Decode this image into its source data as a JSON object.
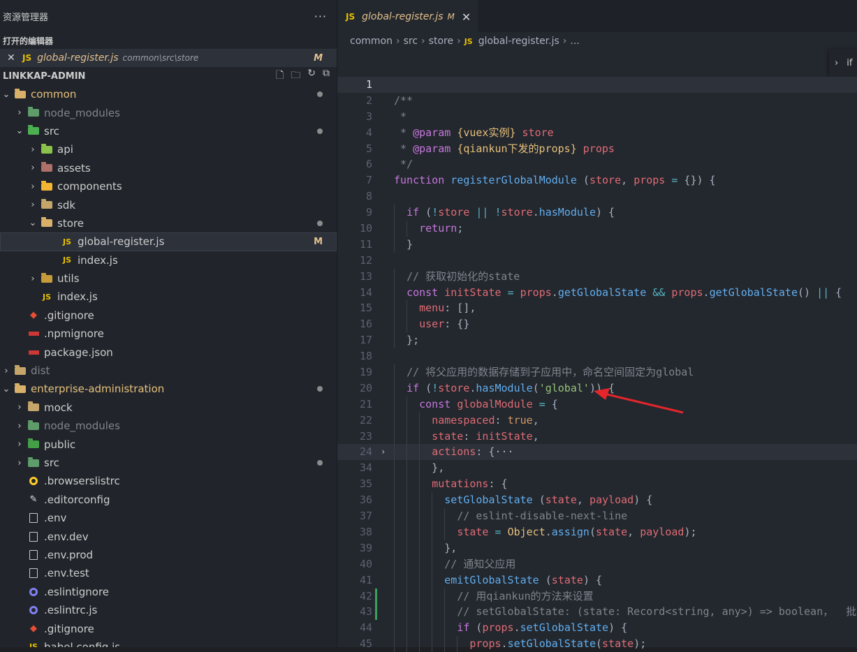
{
  "sidebar": {
    "title": "资源管理器",
    "more": "···",
    "open_editors_title": "打开的编辑器",
    "open_editor": {
      "close": "✕",
      "badge": "JS",
      "name": "global-register.js",
      "path": "common\\src\\store",
      "status": "M"
    },
    "project_title": "LINKKAP-ADMIN",
    "project_actions": [
      "new-file-icon",
      "new-folder-icon",
      "refresh-icon",
      "collapse-all-icon"
    ],
    "tree": [
      {
        "label": "common",
        "depth": 0,
        "kind": "folder-open",
        "chev": "⌄",
        "dot": true,
        "color": "yellow"
      },
      {
        "label": "node_modules",
        "depth": 1,
        "kind": "folder-green",
        "chev": "›",
        "dim": true
      },
      {
        "label": "src",
        "depth": 1,
        "kind": "folder-green-open",
        "chev": "⌄",
        "dot": true
      },
      {
        "label": "api",
        "depth": 2,
        "kind": "folder-api",
        "chev": "›"
      },
      {
        "label": "assets",
        "depth": 2,
        "kind": "folder-assets",
        "chev": "›"
      },
      {
        "label": "components",
        "depth": 2,
        "kind": "folder-comp",
        "chev": "›"
      },
      {
        "label": "sdk",
        "depth": 2,
        "kind": "folder",
        "chev": "›"
      },
      {
        "label": "store",
        "depth": 2,
        "kind": "folder-open",
        "chev": "⌄",
        "dot": true
      },
      {
        "label": "global-register.js",
        "depth": 3,
        "kind": "js",
        "selected": true,
        "mark": "M"
      },
      {
        "label": "index.js",
        "depth": 3,
        "kind": "js"
      },
      {
        "label": "utils",
        "depth": 2,
        "kind": "folder-utils",
        "chev": "›"
      },
      {
        "label": "index.js",
        "depth": 2,
        "kind": "js",
        "nochev": true
      },
      {
        "label": ".gitignore",
        "depth": 1,
        "kind": "git",
        "nochev": true
      },
      {
        "label": ".npmignore",
        "depth": 1,
        "kind": "npm",
        "nochev": true
      },
      {
        "label": "package.json",
        "depth": 1,
        "kind": "npm",
        "nochev": true
      },
      {
        "label": "dist",
        "depth": 0,
        "kind": "folder",
        "chev": "›",
        "dim": true
      },
      {
        "label": "enterprise-administration",
        "depth": 0,
        "kind": "folder-open",
        "chev": "⌄",
        "dot": true,
        "color": "yellow"
      },
      {
        "label": "mock",
        "depth": 1,
        "kind": "folder",
        "chev": "›"
      },
      {
        "label": "node_modules",
        "depth": 1,
        "kind": "folder-green",
        "chev": "›",
        "dim": true
      },
      {
        "label": "public",
        "depth": 1,
        "kind": "folder-public",
        "chev": "›"
      },
      {
        "label": "src",
        "depth": 1,
        "kind": "folder-green",
        "chev": "›",
        "dot": true
      },
      {
        "label": ".browserslistrc",
        "depth": 1,
        "kind": "browsers",
        "nochev": true
      },
      {
        "label": ".editorconfig",
        "depth": 1,
        "kind": "editorconfig",
        "nochev": true
      },
      {
        "label": ".env",
        "depth": 1,
        "kind": "file",
        "nochev": true
      },
      {
        "label": ".env.dev",
        "depth": 1,
        "kind": "file",
        "nochev": true
      },
      {
        "label": ".env.prod",
        "depth": 1,
        "kind": "file",
        "nochev": true
      },
      {
        "label": ".env.test",
        "depth": 1,
        "kind": "file",
        "nochev": true
      },
      {
        "label": ".eslintignore",
        "depth": 1,
        "kind": "eslint",
        "nochev": true
      },
      {
        "label": ".eslintrc.js",
        "depth": 1,
        "kind": "eslint",
        "nochev": true
      },
      {
        "label": ".gitignore",
        "depth": 1,
        "kind": "git",
        "nochev": true
      },
      {
        "label": "babel.config.js",
        "depth": 1,
        "kind": "js",
        "nochev": true
      }
    ]
  },
  "editor": {
    "tab": {
      "badge": "JS",
      "name": "global-register.js",
      "status": "M",
      "close": "✕"
    },
    "breadcrumb": [
      "common",
      "src",
      "store",
      "global-register.js",
      "..."
    ],
    "breadcrumb_badge": "JS",
    "widget_text": "if",
    "lines": [
      {
        "n": "1",
        "t": ""
      },
      {
        "n": "2",
        "t": "/**"
      },
      {
        "n": "3",
        "t": " *"
      },
      {
        "n": "4",
        "t": " * @param {vuex实例} store"
      },
      {
        "n": "5",
        "t": " * @param {qiankun下发的props} props"
      },
      {
        "n": "6",
        "t": " */"
      },
      {
        "n": "7",
        "t": "function registerGlobalModule (store, props = {}) {"
      },
      {
        "n": "8",
        "t": ""
      },
      {
        "n": "9",
        "t": "  if (!store || !store.hasModule) {"
      },
      {
        "n": "10",
        "t": "    return;"
      },
      {
        "n": "11",
        "t": "  }"
      },
      {
        "n": "12",
        "t": ""
      },
      {
        "n": "13",
        "t": "  // 获取初始化的state"
      },
      {
        "n": "14",
        "t": "  const initState = props.getGlobalState && props.getGlobalState() || {"
      },
      {
        "n": "15",
        "t": "    menu: [],"
      },
      {
        "n": "16",
        "t": "    user: {}"
      },
      {
        "n": "17",
        "t": "  };"
      },
      {
        "n": "18",
        "t": ""
      },
      {
        "n": "19",
        "t": "  // 将父应用的数据存储到子应用中，命名空间固定为global"
      },
      {
        "n": "20",
        "t": "  if (!store.hasModule('global')) {"
      },
      {
        "n": "21",
        "t": "    const globalModule = {"
      },
      {
        "n": "22",
        "t": "      namespaced: true,"
      },
      {
        "n": "23",
        "t": "      state: initState,"
      },
      {
        "n": "24",
        "t": "      actions: {···"
      },
      {
        "n": "34",
        "t": "      },"
      },
      {
        "n": "35",
        "t": "      mutations: {"
      },
      {
        "n": "36",
        "t": "        setGlobalState (state, payload) {"
      },
      {
        "n": "37",
        "t": "          // eslint-disable-next-line"
      },
      {
        "n": "38",
        "t": "          state = Object.assign(state, payload);"
      },
      {
        "n": "39",
        "t": "        },"
      },
      {
        "n": "40",
        "t": "        // 通知父应用"
      },
      {
        "n": "41",
        "t": "        emitGlobalState (state) {"
      },
      {
        "n": "42",
        "t": "          // 用qiankun的方法来设置"
      },
      {
        "n": "43",
        "t": "          // setGlobalState: (state: Record<string, any>) => boolean，  批"
      },
      {
        "n": "44",
        "t": "          if (props.setGlobalState) {"
      },
      {
        "n": "45",
        "t": "            props.setGlobalState(state);"
      }
    ]
  },
  "colors": {
    "arrow": "#e3262b"
  }
}
